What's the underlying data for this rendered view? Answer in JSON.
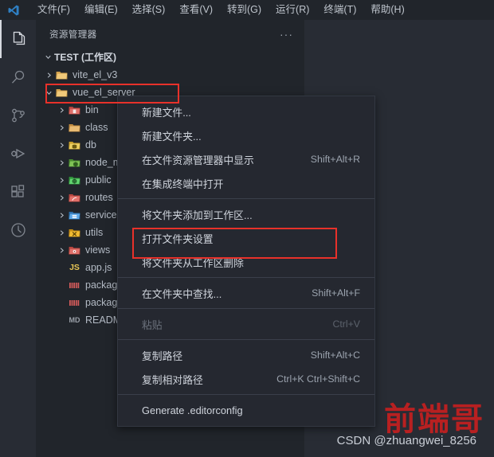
{
  "titlebar": {
    "logo_icon": "vscode-logo-icon",
    "menus": [
      {
        "label": "文件(F)"
      },
      {
        "label": "编辑(E)"
      },
      {
        "label": "选择(S)"
      },
      {
        "label": "查看(V)"
      },
      {
        "label": "转到(G)"
      },
      {
        "label": "运行(R)"
      },
      {
        "label": "终端(T)"
      },
      {
        "label": "帮助(H)"
      }
    ]
  },
  "activitybar": {
    "items": [
      {
        "name": "explorer",
        "icon": "files-icon",
        "active": true
      },
      {
        "name": "search",
        "icon": "search-icon",
        "active": false
      },
      {
        "name": "source-control",
        "icon": "source-control-icon",
        "active": false
      },
      {
        "name": "run-and-debug",
        "icon": "run-debug-icon",
        "active": false
      },
      {
        "name": "extensions",
        "icon": "extensions-icon",
        "active": false
      },
      {
        "name": "timeline",
        "icon": "clock-icon",
        "active": false
      }
    ]
  },
  "sidebar": {
    "title": "资源管理器",
    "actions_icon": "more-actions-icon",
    "workspace": {
      "label": "TEST (工作区)",
      "expanded": true
    },
    "tree": [
      {
        "label": "vite_el_v3",
        "type": "folder",
        "expanded": false,
        "indent": 1,
        "icon": "folder-icon",
        "color": "#d3a14b"
      },
      {
        "label": "vue_el_server",
        "type": "folder",
        "expanded": true,
        "indent": 1,
        "icon": "folder-open-icon",
        "color": "#d3a14b",
        "highlighted": true
      },
      {
        "label": "bin",
        "type": "folder",
        "expanded": false,
        "indent": 2,
        "icon": "folder-bin-icon",
        "color": "#d45b5b"
      },
      {
        "label": "class",
        "type": "folder",
        "expanded": false,
        "indent": 2,
        "icon": "folder-class-icon",
        "color": "#d8a257"
      },
      {
        "label": "db",
        "type": "folder",
        "expanded": false,
        "indent": 2,
        "icon": "folder-db-icon",
        "color": "#d9b44a"
      },
      {
        "label": "node_modules",
        "type": "folder",
        "expanded": false,
        "indent": 2,
        "icon": "folder-node-icon",
        "color": "#6cb84a"
      },
      {
        "label": "public",
        "type": "folder",
        "expanded": false,
        "indent": 2,
        "icon": "folder-public-icon",
        "color": "#4caf50"
      },
      {
        "label": "routes",
        "type": "folder",
        "expanded": false,
        "indent": 2,
        "icon": "folder-routes-icon",
        "color": "#d45b5b"
      },
      {
        "label": "service",
        "type": "folder",
        "expanded": false,
        "indent": 2,
        "icon": "folder-service-icon",
        "color": "#4a9ede"
      },
      {
        "label": "utils",
        "type": "folder",
        "expanded": false,
        "indent": 2,
        "icon": "folder-utils-icon",
        "color": "#e0a21f"
      },
      {
        "label": "views",
        "type": "folder",
        "expanded": false,
        "indent": 2,
        "icon": "folder-views-icon",
        "color": "#d45b5b"
      },
      {
        "label": "app.js",
        "type": "file",
        "indent": 2,
        "icon": "js-file-icon",
        "badge": "JS",
        "color": "#e5c455"
      },
      {
        "label": "package.json",
        "type": "file",
        "indent": 2,
        "icon": "json-file-icon",
        "badge": "{}",
        "color": "#d45b5b"
      },
      {
        "label": "package-lock.json",
        "type": "file",
        "indent": 2,
        "icon": "json-file-icon",
        "badge": "{}",
        "color": "#d45b5b"
      },
      {
        "label": "README.md",
        "type": "file",
        "indent": 2,
        "icon": "markdown-file-icon",
        "badge": "MD",
        "color": "#9aa0a8"
      }
    ]
  },
  "context_menu": {
    "items": [
      {
        "label": "新建文件...",
        "shortcut": "",
        "type": "item",
        "disabled": false
      },
      {
        "label": "新建文件夹...",
        "shortcut": "",
        "type": "item",
        "disabled": false
      },
      {
        "label": "在文件资源管理器中显示",
        "shortcut": "Shift+Alt+R",
        "type": "item",
        "disabled": false
      },
      {
        "label": "在集成终端中打开",
        "shortcut": "",
        "type": "item",
        "disabled": false
      },
      {
        "type": "separator"
      },
      {
        "label": "将文件夹添加到工作区...",
        "shortcut": "",
        "type": "item",
        "disabled": false
      },
      {
        "label": "打开文件夹设置",
        "shortcut": "",
        "type": "item",
        "disabled": false
      },
      {
        "label": "将文件夹从工作区删除",
        "shortcut": "",
        "type": "item",
        "disabled": false,
        "highlighted": true
      },
      {
        "type": "separator"
      },
      {
        "label": "在文件夹中查找...",
        "shortcut": "Shift+Alt+F",
        "type": "item",
        "disabled": false
      },
      {
        "type": "separator"
      },
      {
        "label": "粘贴",
        "shortcut": "Ctrl+V",
        "type": "item",
        "disabled": true
      },
      {
        "type": "separator"
      },
      {
        "label": "复制路径",
        "shortcut": "Shift+Alt+C",
        "type": "item",
        "disabled": false
      },
      {
        "label": "复制相对路径",
        "shortcut": "Ctrl+K Ctrl+Shift+C",
        "type": "item",
        "disabled": false
      },
      {
        "type": "separator"
      },
      {
        "label": "Generate .editorconfig",
        "shortcut": "",
        "type": "item",
        "disabled": false
      }
    ]
  },
  "annotations": {
    "color": "#e8312a",
    "boxes": [
      {
        "name": "folder-highlight",
        "target": "vue_el_server"
      },
      {
        "name": "menuitem-highlight",
        "target": "将文件夹从工作区删除"
      }
    ]
  },
  "watermark": {
    "big_text": "前端哥",
    "small_text": "CSDN @zhuangwei_8256",
    "big_color": "#c02020",
    "small_color": "#c9ced6"
  }
}
